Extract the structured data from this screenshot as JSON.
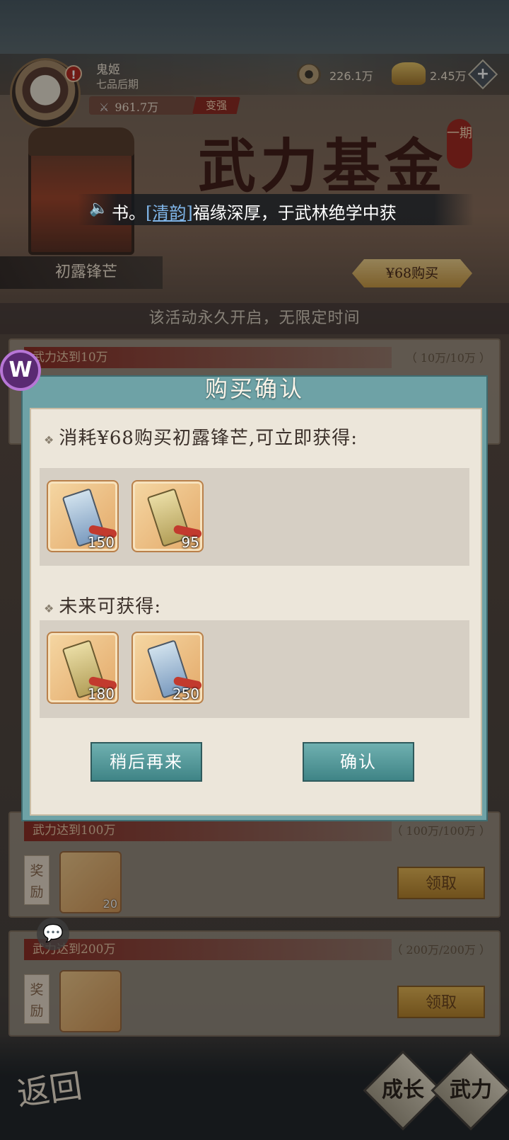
{
  "player": {
    "name": "鬼姬",
    "rank": "七品后期",
    "alert": "!",
    "power": "961.7万",
    "upgrade_label": "变强"
  },
  "currency": {
    "coins": "226.1万",
    "ingots": "2.45万",
    "add_label": "+"
  },
  "banner": {
    "title": "武力基金",
    "period": "一期",
    "chest_label": "初露锋芒",
    "buy_label": "¥68购买",
    "permanent_notice": "该活动永久开启，无限定时间"
  },
  "ticker": {
    "speaker": "🔈",
    "prefix": "书。",
    "name": "[清韵]",
    "suffix": "福缘深厚，于武林绝学中获"
  },
  "rows": [
    {
      "condition": "武力达到10万",
      "progress": "（ 10万/10万 ）"
    },
    {
      "condition": "武力达到100万",
      "progress": "（ 100万/100万 ）",
      "reward_label": "奖励",
      "item_count": "20",
      "claim_label": "领取"
    },
    {
      "condition": "武力达到200万",
      "progress": "（ 200万/200万 ）",
      "reward_label": "奖励",
      "claim_label": "领取"
    }
  ],
  "dialog": {
    "title": "购买确认",
    "immediate_title": "消耗¥68购买初露锋芒,可立即获得:",
    "immediate_items": [
      {
        "icon": "blue-token-icon",
        "count": "150"
      },
      {
        "icon": "gold-token-icon",
        "count": "95"
      }
    ],
    "future_title": "未来可获得:",
    "future_items": [
      {
        "icon": "gold-token-icon",
        "count": "180"
      },
      {
        "icon": "blue-token-icon",
        "count": "250"
      }
    ],
    "later_label": "稍后再来",
    "confirm_label": "确认"
  },
  "bottom": {
    "back_label": "返回",
    "tab_growth": "成长",
    "tab_power": "武力"
  },
  "floating": {
    "w_badge": "W",
    "chat_icon": "💬"
  },
  "colors": {
    "dialog_teal": "#6ea2a6",
    "button_teal": "#3f8486",
    "banner_red": "#8d2f26",
    "buy_gold": "#c99a45"
  }
}
